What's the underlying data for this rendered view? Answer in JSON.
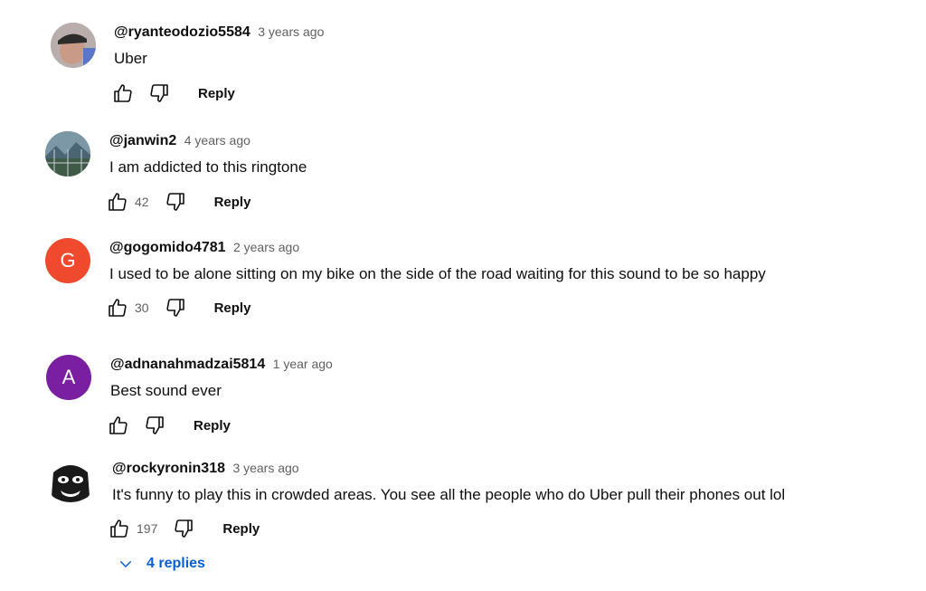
{
  "comments": [
    {
      "author": "@ryanteodozio5584",
      "time": "3 years ago",
      "text": "Uber",
      "likes": "",
      "reply": "Reply",
      "avatar_icon": "photo-avatar-person-cap",
      "avatar_color": "#8a7f7a"
    },
    {
      "author": "@janwin2",
      "time": "4 years ago",
      "text": "I am addicted to this ringtone",
      "likes": "42",
      "reply": "Reply",
      "avatar_icon": "photo-avatar-landscape",
      "avatar_color": "#5f7a85"
    },
    {
      "author": "@gogomido4781",
      "time": "2 years ago",
      "text": "I used to be alone sitting on my bike on the side of the road waiting for this sound to be so happy",
      "likes": "30",
      "reply": "Reply",
      "avatar_letter": "G",
      "avatar_color": "#ef4a2e"
    },
    {
      "author": "@adnanahmadzai5814",
      "time": "1 year ago",
      "text": "Best sound ever",
      "likes": "",
      "reply": "Reply",
      "avatar_letter": "A",
      "avatar_color": "#7b1fa2"
    },
    {
      "author": "@rockyronin318",
      "time": "3 years ago",
      "text": "It's funny to play this in crowded areas. You see all the people who do Uber pull their phones out lol",
      "likes": "197",
      "reply": "Reply",
      "avatar_icon": "cartoon-face-avatar",
      "avatar_color": "#ffffff"
    }
  ],
  "replies_toggle": {
    "label": "4 replies",
    "icon": "chevron-down-icon",
    "color": "#065fd4"
  },
  "icons": {
    "like": "thumbs-up-icon",
    "dislike": "thumbs-down-icon"
  }
}
